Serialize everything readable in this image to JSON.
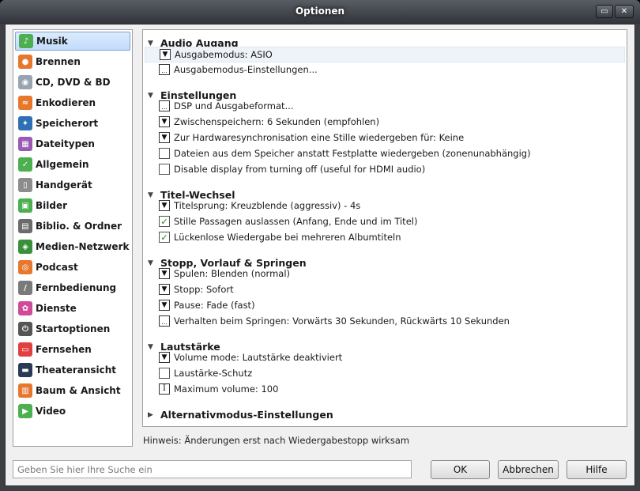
{
  "window": {
    "title": "Optionen"
  },
  "sidebar": {
    "items": [
      {
        "label": "Musik",
        "icon": "music-icon",
        "color": "#4caf50",
        "glyph": "♪"
      },
      {
        "label": "Brennen",
        "icon": "burn-icon",
        "color": "#e8772e",
        "glyph": "●"
      },
      {
        "label": "CD, DVD & BD",
        "icon": "disc-icon",
        "color": "#9aa4b0",
        "glyph": "◉"
      },
      {
        "label": "Enkodieren",
        "icon": "encode-icon",
        "color": "#e8772e",
        "glyph": "≈"
      },
      {
        "label": "Speicherort",
        "icon": "location-icon",
        "color": "#2f6fb5",
        "glyph": "✦"
      },
      {
        "label": "Dateitypen",
        "icon": "filetype-icon",
        "color": "#9b59b6",
        "glyph": "▦"
      },
      {
        "label": "Allgemein",
        "icon": "general-icon",
        "color": "#4caf50",
        "glyph": "✓"
      },
      {
        "label": "Handgerät",
        "icon": "device-icon",
        "color": "#8c8c8c",
        "glyph": "▯"
      },
      {
        "label": "Bilder",
        "icon": "pictures-icon",
        "color": "#4caf50",
        "glyph": "▣"
      },
      {
        "label": "Biblio. & Ordner",
        "icon": "library-icon",
        "color": "#6b6b6b",
        "glyph": "▤"
      },
      {
        "label": "Medien-Netzwerk",
        "icon": "network-icon",
        "color": "#3a8f3a",
        "glyph": "◈"
      },
      {
        "label": "Podcast",
        "icon": "podcast-icon",
        "color": "#e8772e",
        "glyph": "◎"
      },
      {
        "label": "Fernbedienung",
        "icon": "remote-icon",
        "color": "#7a7a7a",
        "glyph": "/"
      },
      {
        "label": "Dienste",
        "icon": "services-icon",
        "color": "#d14a9a",
        "glyph": "✿"
      },
      {
        "label": "Startoptionen",
        "icon": "startup-icon",
        "color": "#555555",
        "glyph": "⏻"
      },
      {
        "label": "Fernsehen",
        "icon": "tv-icon",
        "color": "#e04040",
        "glyph": "▭"
      },
      {
        "label": "Theateransicht",
        "icon": "theater-icon",
        "color": "#2a3a55",
        "glyph": "▬"
      },
      {
        "label": "Baum & Ansicht",
        "icon": "tree-view-icon",
        "color": "#e8772e",
        "glyph": "▥"
      },
      {
        "label": "Video",
        "icon": "video-icon",
        "color": "#4caf50",
        "glyph": "▶"
      }
    ]
  },
  "sections": [
    {
      "title": "Audio Augang",
      "expanded": true
    },
    {
      "title": "Einstellungen",
      "expanded": true
    },
    {
      "title": "Titel-Wechsel",
      "expanded": true
    },
    {
      "title": "Stopp, Vorlauf & Springen",
      "expanded": true
    },
    {
      "title": "Lautstärke",
      "expanded": true
    },
    {
      "title": "Alternativmodus-Einstellungen",
      "expanded": false
    }
  ],
  "options": [
    {
      "label": "Ausgabemodus: ASIO",
      "control": "dropdown",
      "section": 0
    },
    {
      "label": "Ausgabemodus-Einstellungen...",
      "control": "ellipsis",
      "section": 0
    },
    {
      "label": "DSP und Ausgabeformat...",
      "control": "ellipsis",
      "section": 1
    },
    {
      "label": "Zwischenspeichern: 6 Sekunden (empfohlen)",
      "control": "dropdown",
      "section": 1
    },
    {
      "label": "Zur Hardwaresynchronisation eine Stille wiedergeben für: Keine",
      "control": "dropdown",
      "section": 1
    },
    {
      "label": "Dateien aus dem Speicher anstatt Festplatte wiedergeben (zonenunabhängig)",
      "control": "checkbox",
      "checked": false,
      "section": 1
    },
    {
      "label": "Disable display from turning off (useful for HDMI audio)",
      "control": "checkbox",
      "checked": false,
      "section": 1
    },
    {
      "label": "Titelsprung: Kreuzblende (aggressiv) - 4s",
      "control": "dropdown",
      "section": 2
    },
    {
      "label": "Stille Passagen auslassen (Anfang, Ende und im Titel)",
      "control": "checkbox",
      "checked": true,
      "section": 2
    },
    {
      "label": "Lückenlose Wiedergabe bei mehreren Albumtiteln",
      "control": "checkbox",
      "checked": true,
      "section": 2
    },
    {
      "label": "Spulen: Blenden (normal)",
      "control": "dropdown",
      "section": 3
    },
    {
      "label": "Stopp: Sofort",
      "control": "dropdown",
      "section": 3
    },
    {
      "label": "Pause: Fade (fast)",
      "control": "dropdown",
      "section": 3
    },
    {
      "label": "Verhalten beim Springen: Vorwärts 30 Sekunden, Rückwärts 10 Sekunden",
      "control": "ellipsis",
      "section": 3
    },
    {
      "label": "Volume mode: Lautstärke deaktiviert",
      "control": "dropdown",
      "section": 4
    },
    {
      "label": "Laustärke-Schutz",
      "control": "checkbox",
      "checked": false,
      "section": 4
    },
    {
      "label": "Maximum volume: 100",
      "control": "text-input",
      "section": 4
    }
  ],
  "glyphs": {
    "dropdown": "▼",
    "ellipsis": "...",
    "check": "✓",
    "text-input": "I",
    "expanded": "▼",
    "collapsed": "▶"
  },
  "hint": "Hinweis: Änderungen erst nach Wiedergabestopp wirksam",
  "search": {
    "placeholder": "Geben Sie hier Ihre Suche ein",
    "value": ""
  },
  "buttons": {
    "ok": "OK",
    "cancel": "Abbrechen",
    "help": "Hilfe"
  }
}
